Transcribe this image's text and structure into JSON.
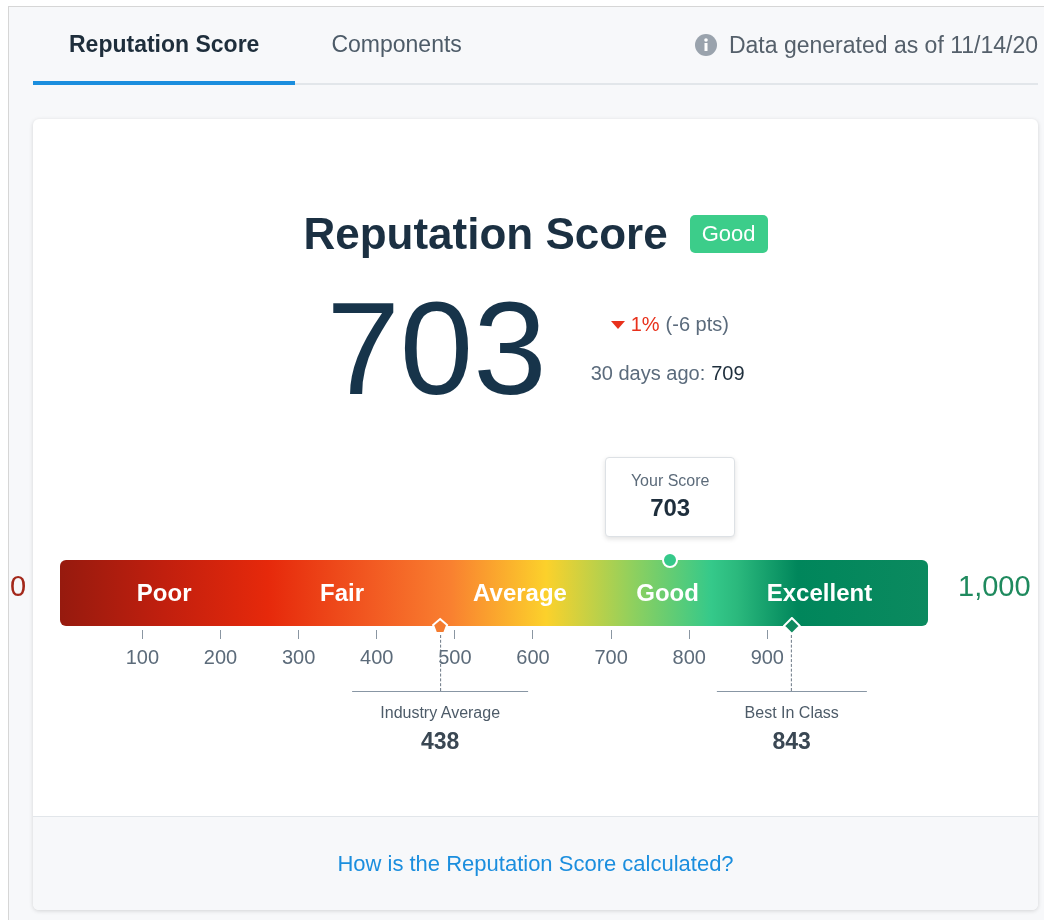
{
  "tabs": [
    {
      "label": "Reputation Score",
      "selected": true
    },
    {
      "label": "Components",
      "selected": false
    }
  ],
  "data_note": "Data generated as of 11/14/20",
  "card": {
    "title": "Reputation Score",
    "rating_badge": "Good",
    "score": "703",
    "change": {
      "declined": true,
      "percent": "1%",
      "points": "(-6 pts)"
    },
    "previous": {
      "label": "30 days ago:",
      "value": "709"
    }
  },
  "gauge": {
    "min_label": "0",
    "max_label": "1,000",
    "bands": [
      "Poor",
      "Fair",
      "Average",
      "Good",
      "Excellent"
    ],
    "ticks": [
      "100",
      "200",
      "300",
      "400",
      "500",
      "600",
      "700",
      "800",
      "900"
    ],
    "your_score": {
      "label": "Your Score",
      "value": "703",
      "level": 0.703
    },
    "benchmarks": [
      {
        "kind": "pentagon",
        "label": "Industry Average",
        "value": "438",
        "level": 0.438,
        "color": "#f47c30"
      },
      {
        "kind": "diamond",
        "label": "Best In Class",
        "value": "843",
        "level": 0.843,
        "color": "#0e8a5f"
      }
    ]
  },
  "footer_link": "How is the Reputation Score calculated?"
}
